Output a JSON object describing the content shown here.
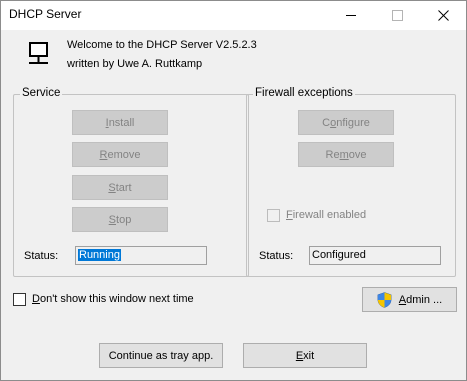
{
  "window": {
    "title": "DHCP Server",
    "minimize_icon": "minimize-icon",
    "maximize_icon": "maximize-icon",
    "close_icon": "close-icon"
  },
  "header": {
    "icon": "network-computer-icon",
    "welcome": "Welcome to the DHCP Server V2.5.2.3",
    "author": "written by Uwe A. Ruttkamp"
  },
  "service": {
    "group_title": "Service",
    "install": {
      "access": "I",
      "rest": "nstall"
    },
    "remove": {
      "access": "R",
      "rest": "emove"
    },
    "start": {
      "access": "S",
      "rest": "tart"
    },
    "stop": {
      "access": "S",
      "rest": "top"
    },
    "status_label": "Status:",
    "status_value": "Running"
  },
  "firewall": {
    "group_title": "Firewall exceptions",
    "configure": {
      "pre": "C",
      "access": "o",
      "rest": "nfigure"
    },
    "remove": {
      "pre": "Re",
      "access": "m",
      "rest": "ove"
    },
    "enabled": {
      "access": "F",
      "rest": "irewall enabled"
    },
    "status_label": "Status:",
    "status_value": "Configured"
  },
  "options": {
    "dont_show": {
      "access": "D",
      "rest": "on't show this window next time"
    },
    "admin": {
      "icon": "uac-shield-icon",
      "access": "A",
      "rest": "dmin ..."
    }
  },
  "footer": {
    "tray": "Continue as tray app.",
    "exit": {
      "access": "E",
      "rest": "xit"
    }
  },
  "colors": {
    "accent": "#0078d7",
    "background": "#f0f0f0"
  }
}
